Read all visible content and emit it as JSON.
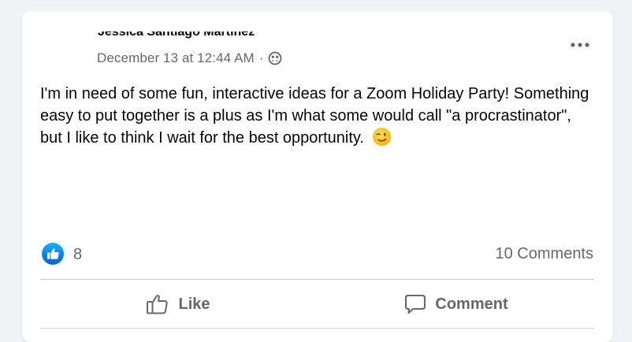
{
  "post": {
    "author_name_clipped": "Jessica Santiago Martinez",
    "timestamp": "December 13 at 12:44 AM",
    "separator": "·",
    "audience_icon": "group-audience-icon",
    "more_icon": "more-options-icon",
    "text": "I'm in need of some fun, interactive ideas for a Zoom Holiday Party! Something easy to put together is a plus as I'm what some would call \"a procrastinator\", but I like to think I wait for the best opportunity.",
    "emoji": "winking-face-emoji"
  },
  "reactions": {
    "like_icon": "thumbs-up-reaction-icon",
    "like_count": "8",
    "comments_label": "10 Comments"
  },
  "actions": {
    "like_label": "Like",
    "like_icon": "thumbs-up-outline-icon",
    "comment_label": "Comment",
    "comment_icon": "comment-bubble-icon"
  },
  "colors": {
    "background": "#f0f2f5",
    "card": "#ffffff",
    "secondary_text": "#65676b",
    "like_blue": "#1877f2",
    "divider": "#ced0d4"
  }
}
